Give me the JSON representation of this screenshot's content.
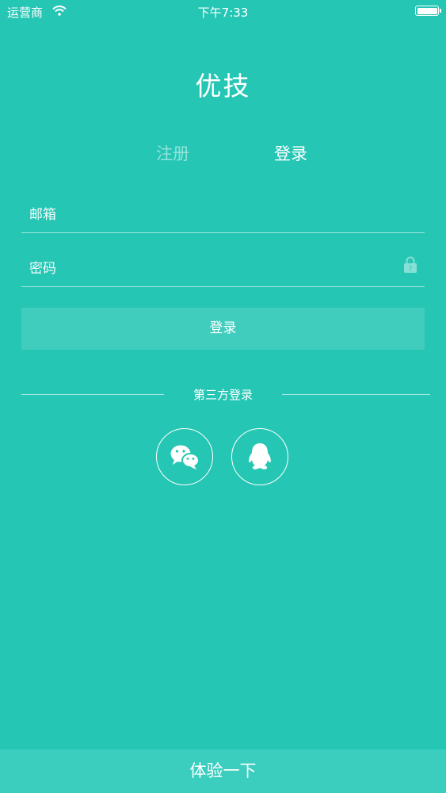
{
  "status_bar": {
    "carrier": "运营商",
    "time": "下午7:33"
  },
  "app": {
    "title": "优技"
  },
  "tabs": [
    {
      "label": "注册",
      "active": false
    },
    {
      "label": "登录",
      "active": true
    }
  ],
  "form": {
    "email_placeholder": "邮箱",
    "email_value": "",
    "password_placeholder": "密码",
    "password_value": "",
    "login_label": "登录"
  },
  "third_party": {
    "label": "第三方登录",
    "providers": [
      {
        "name": "wechat-icon"
      },
      {
        "name": "qq-icon"
      }
    ]
  },
  "trial": {
    "label": "体验一下"
  },
  "colors": {
    "background": "#26c6b4",
    "accent": "#ffffff",
    "trial_bar": "#3bcdbe"
  }
}
